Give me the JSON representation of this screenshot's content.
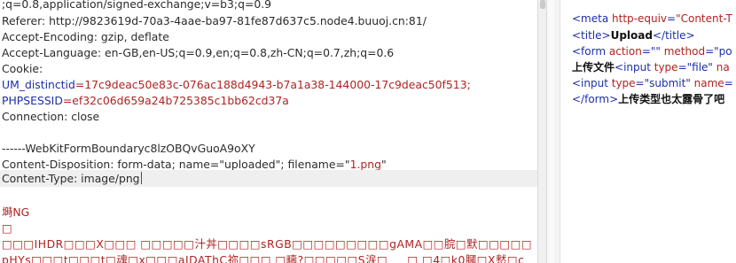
{
  "request": {
    "line_accept": ";q=0.8,application/signed-exchange;v=b3;q=0.9",
    "line_referer": "Referer: http://9823619d-70a3-4aae-ba97-81fe87d637c5.node4.buuoj.cn:81/",
    "line_encoding": "Accept-Encoding: gzip, deflate",
    "line_language": "Accept-Language: en-GB,en-US;q=0.9,en;q=0.8,zh-CN;q=0.7,zh;q=0.6",
    "cookie_label": "Cookie:",
    "cookie1_key": "UM_distinctid",
    "cookie1_val": "=17c9deac50e83c-076ac188d4943-b7a1a38-144000-17c9deac50f513;",
    "cookie2_key": "PHPSESSID",
    "cookie2_val": "=ef32c06d659a24b725385c1bb62cd37a",
    "line_connection": "Connection: close",
    "boundary": "------WebKitFormBoundaryc8lzOBQvGuoA9oXY",
    "disp_prefix": "Content-Disposition: form-data; name=\"uploaded\"; filename=\"",
    "disp_filename": "1.png",
    "disp_suffix": "\"",
    "content_type": "Content-Type: image/png",
    "bin1": "塒NG",
    "bin2": "□",
    "bin3": "□□□IHDR□□□X□□□ □□□□□汁丼□□□□sRGB□□□□□□□□□gAMA□□脘□默□□□□□",
    "bin4": "pHYs□□□t□□□t□魂□x□□□aIDAThC祢□□□ □疇?□□□□□S涙□     □ □4□k0膕□X憖□c"
  },
  "response": {
    "l1_open": "<meta",
    "l1_attr": " http-equiv",
    "l1_eq": "=",
    "l1_val": "\"Content-T",
    "l2_open": "<title>",
    "l2_text": "Upload",
    "l2_close": "</title>",
    "l3_open": "<form",
    "l3_attr1": " action",
    "l3_val1": "=\"\"",
    "l3_attr2": " method",
    "l3_val2": "=\"po",
    "l4_text": "上传文件",
    "l4_open": "<input",
    "l4_attr": " type",
    "l4_val": "=\"file\"",
    "l4_attr2": " na",
    "l5_open": "<input",
    "l5_attr": " type",
    "l5_val": "=\"submit\"",
    "l5_attr2": " name",
    "l5_eq": "=",
    "l6_close": "</form>",
    "l6_text": "上传类型也太露骨了吧"
  }
}
